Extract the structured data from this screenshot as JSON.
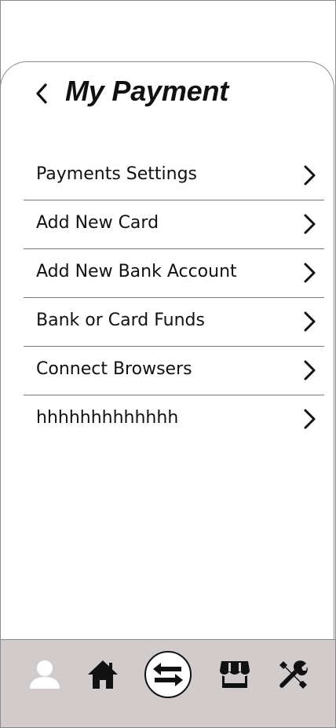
{
  "header": {
    "title": "My Payment",
    "back_icon": "chevron-left-icon"
  },
  "menu": {
    "items": [
      {
        "label": "Payments Settings",
        "icon": "chevron-right-icon"
      },
      {
        "label": "Add New Card",
        "icon": "chevron-right-icon"
      },
      {
        "label": "Add New Bank Account",
        "icon": "chevron-right-icon"
      },
      {
        "label": "Bank or Card Funds",
        "icon": "chevron-right-icon"
      },
      {
        "label": "Connect Browsers",
        "icon": "chevron-right-icon"
      },
      {
        "label": "hhhhhhhhhhhhh",
        "icon": "chevron-right-icon"
      }
    ]
  },
  "tabbar": {
    "items": [
      {
        "icon": "user-icon",
        "active": false
      },
      {
        "icon": "home-icon",
        "active": false
      },
      {
        "icon": "transfer-arrows-icon",
        "active": true
      },
      {
        "icon": "store-icon",
        "active": false
      },
      {
        "icon": "tools-icon",
        "active": false
      }
    ]
  },
  "colors": {
    "tabbar_background": "#d2cbcc",
    "text": "#111111",
    "divider": "#7a7a7a",
    "profile_icon": "#ffffff"
  }
}
